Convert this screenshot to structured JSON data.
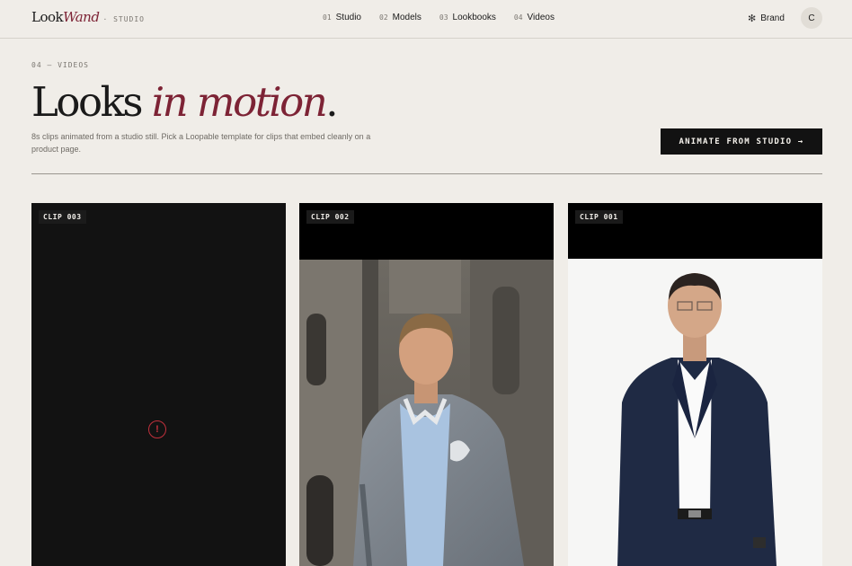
{
  "header": {
    "logo_main": "Look",
    "logo_accent": "Wand",
    "logo_suffix": "· STUDIO",
    "nav": [
      {
        "num": "01",
        "label": "Studio"
      },
      {
        "num": "02",
        "label": "Models"
      },
      {
        "num": "03",
        "label": "Lookbooks"
      },
      {
        "num": "04",
        "label": "Videos"
      }
    ],
    "brand_label": "Brand",
    "brand_icon": "sparkle-icon",
    "avatar_initial": "C"
  },
  "hero": {
    "eyebrow": "04 — VIDEOS",
    "title_plain": "Looks",
    "title_accent": "in motion",
    "title_period": ".",
    "subcopy": "8s clips animated from a studio still. Pick a Loopable template for clips that embed cleanly on a product page.",
    "cta_label": "ANIMATE FROM STUDIO →"
  },
  "clips": [
    {
      "tag": "CLIP 003",
      "state": "error",
      "icon": "error-icon",
      "error_glyph": "!"
    },
    {
      "tag": "CLIP 002",
      "state": "ready",
      "subject": "man in grey varsity jacket in front of stone building"
    },
    {
      "tag": "CLIP 001",
      "state": "ready",
      "subject": "man in navy suit on white backdrop"
    }
  ],
  "colors": {
    "background": "#f0ede8",
    "accent": "#7d2335",
    "ink": "#121212",
    "error": "#c0303c"
  }
}
